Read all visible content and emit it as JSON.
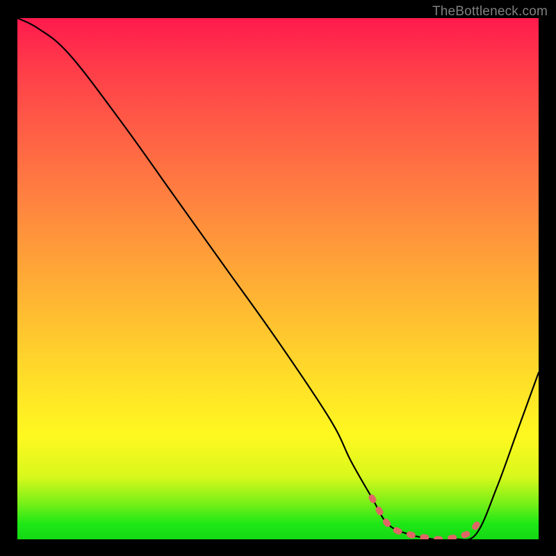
{
  "watermark": "TheBottleneck.com",
  "chart_data": {
    "type": "line",
    "title": "",
    "xlabel": "",
    "ylabel": "",
    "xlim": [
      0,
      100
    ],
    "ylim": [
      0,
      100
    ],
    "series": [
      {
        "name": "bottleneck-curve",
        "color": "#000000",
        "x": [
          0,
          4,
          10,
          20,
          30,
          40,
          50,
          60,
          64,
          68,
          71,
          75,
          80,
          84,
          88,
          92,
          96,
          100
        ],
        "values": [
          100,
          98,
          93,
          80,
          66,
          52,
          38,
          23,
          15,
          8,
          3,
          1,
          0,
          0,
          1,
          10,
          21,
          32
        ]
      },
      {
        "name": "optimal-zone",
        "color": "#e06666",
        "x": [
          68,
          71,
          73,
          75,
          77,
          79,
          81,
          83,
          85,
          87,
          89
        ],
        "values": [
          8,
          3,
          1.6,
          1,
          0.5,
          0.3,
          0,
          0.2,
          0.6,
          1.5,
          4
        ]
      }
    ]
  }
}
